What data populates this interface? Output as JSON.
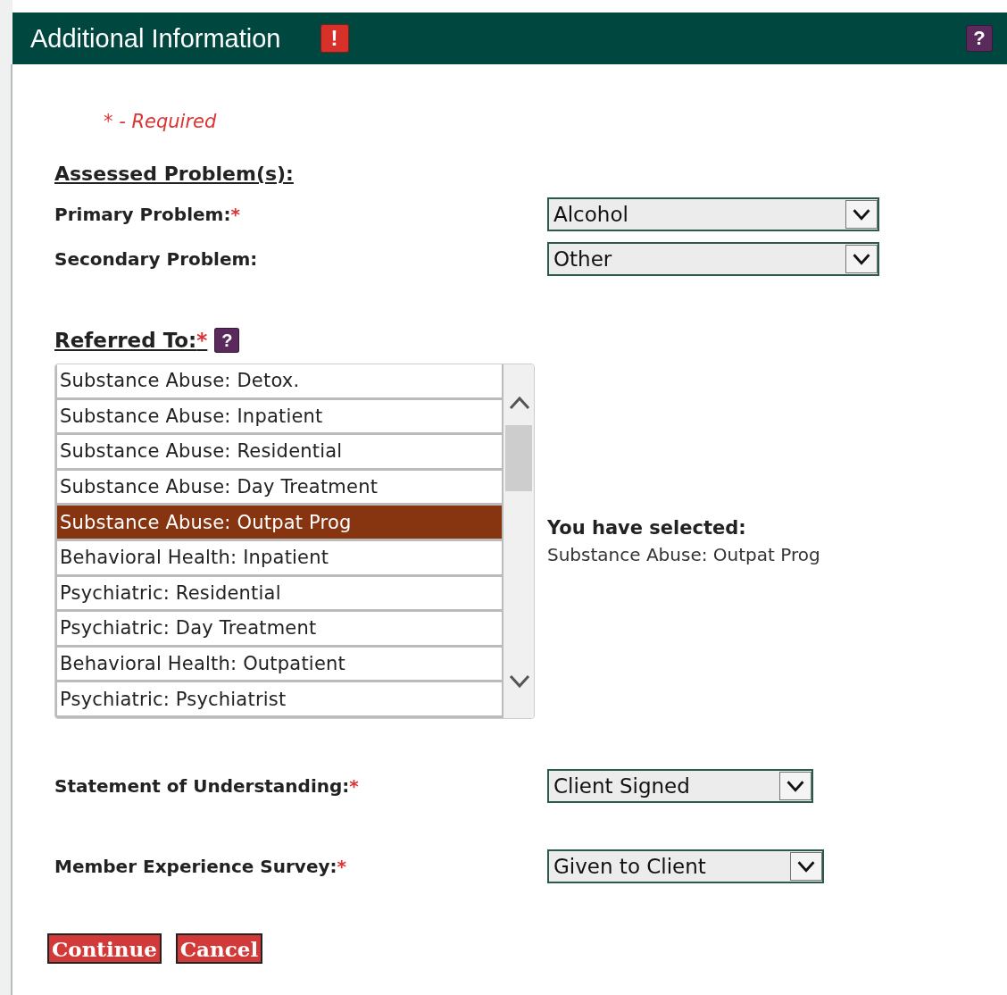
{
  "header": {
    "title": "Additional Information",
    "alert_badge": "!",
    "help_button": "?"
  },
  "required_note": "* - Required",
  "section_heading": "Assessed Problem(s):",
  "problem_fields": [
    {
      "label": "Primary Problem:",
      "required_mark": "*",
      "value": "Alcohol"
    },
    {
      "label": "Secondary Problem:",
      "value": "Other"
    }
  ],
  "referred_to": {
    "label": "Referred To:",
    "required_mark": "*",
    "help_button": "?",
    "items": [
      {
        "label": "Substance Abuse: Detox.",
        "selected": false
      },
      {
        "label": "Substance Abuse: Inpatient",
        "selected": false
      },
      {
        "label": "Substance Abuse: Residential",
        "selected": false
      },
      {
        "label": "Substance Abuse: Day Treatment",
        "selected": false
      },
      {
        "label": "Substance Abuse: Outpat Prog",
        "selected": true
      },
      {
        "label": "Behavioral Health: Inpatient",
        "selected": false
      },
      {
        "label": "Psychiatric: Residential",
        "selected": false
      },
      {
        "label": "Psychiatric: Day Treatment",
        "selected": false
      },
      {
        "label": "Behavioral Health: Outpatient",
        "selected": false
      },
      {
        "label": "Psychiatric: Psychiatrist",
        "selected": false
      }
    ],
    "selection_heading": "You have selected:",
    "selection_value": "Substance Abuse: Outpat Prog"
  },
  "other_fields": [
    {
      "label": "Statement of Understanding:",
      "required_mark": "*",
      "value": "Client Signed"
    },
    {
      "label": "Member Experience Survey:",
      "required_mark": "*",
      "value": "Given to Client"
    }
  ],
  "buttons": [
    "Continue",
    "Cancel"
  ]
}
